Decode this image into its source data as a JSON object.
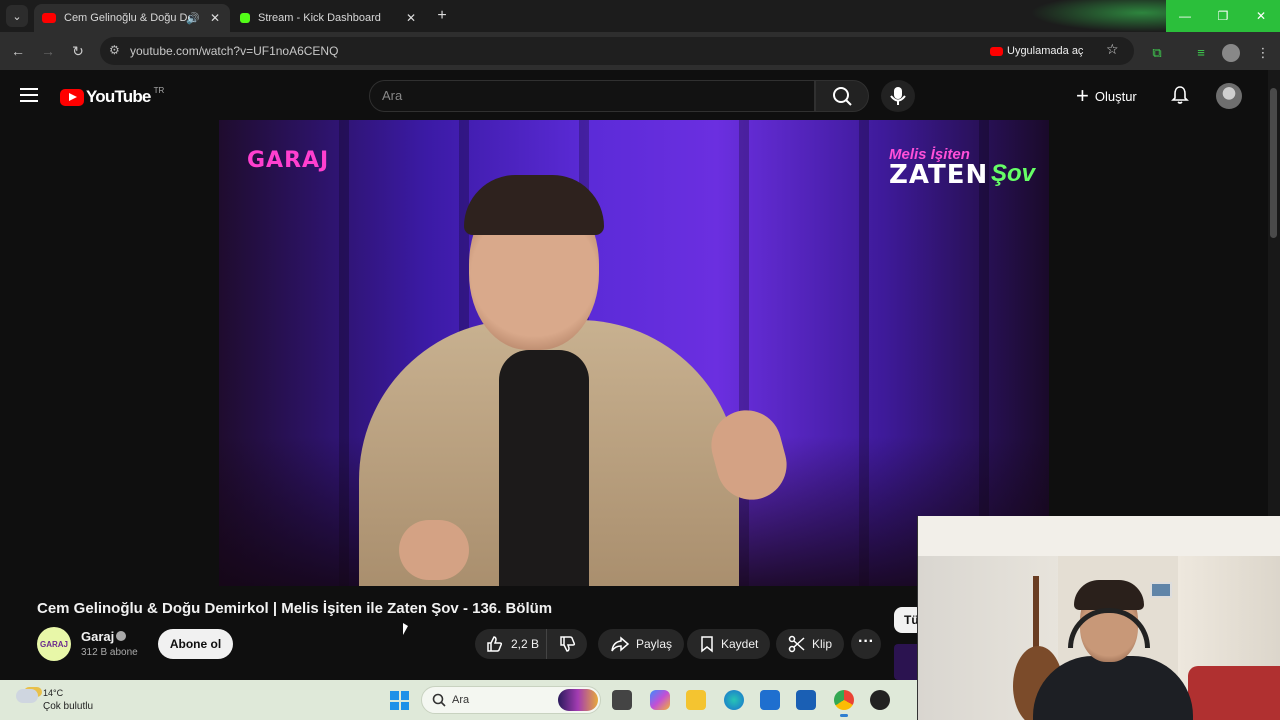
{
  "browser": {
    "tabs": [
      {
        "title": "Cem Gelinoğlu & Doğu De",
        "favicon": "youtube-icon",
        "color": "#ff0000",
        "active": true
      },
      {
        "title": "Stream - Kick Dashboard",
        "favicon": "kick-icon",
        "color": "#53fc18",
        "active": false
      }
    ],
    "url": "youtube.com/watch?v=UF1noA6CENQ",
    "open_in_app_label": "Uygulamada aç"
  },
  "youtube": {
    "logo_text": "YouTube",
    "country_code": "TR",
    "search_placeholder": "Ara",
    "create_label": "Oluştur"
  },
  "video": {
    "overlay_left": "GARAJ",
    "overlay_right_top": "Melis İşiten",
    "overlay_right_main": "ZATEN",
    "overlay_right_tail": "Şov",
    "title": "Cem Gelinoğlu & Doğu Demirkol | Melis İşiten ile Zaten Şov - 136. Bölüm",
    "channel": {
      "name": "Garaj",
      "avatar_text": "GARAJ",
      "subscribers": "312 B abone",
      "subscribe_label": "Abone ol"
    },
    "actions": {
      "likes": "2,2 B",
      "share_label": "Paylaş",
      "save_label": "Kaydet",
      "clip_label": "Klip",
      "more_label": "···"
    },
    "side_chip": "Tü"
  },
  "taskbar": {
    "temperature": "14°C",
    "weather": "Çok bulutlu",
    "search_label": "Ara"
  },
  "colors": {
    "youtube_red": "#ff0000",
    "kick_green": "#53fc18",
    "window_controls": "#2bbf3b"
  }
}
